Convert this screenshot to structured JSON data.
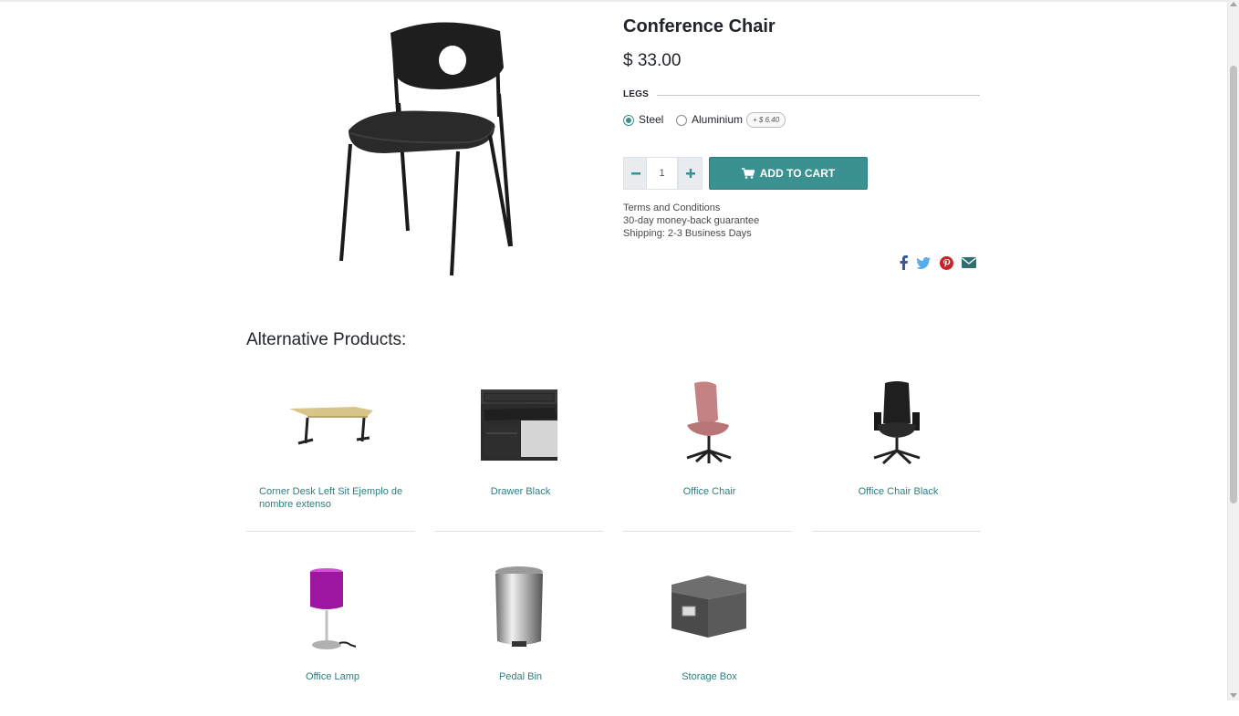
{
  "product": {
    "name": "Conference Chair",
    "price": "$ 33.00",
    "attribute": {
      "label": "LEGS",
      "options": [
        {
          "label": "Steel",
          "selected": true
        },
        {
          "label": "Aluminium",
          "selected": false,
          "extra_price": "+ $ 6.40"
        }
      ]
    },
    "quantity": "1",
    "add_to_cart_label": "ADD TO CART",
    "info": [
      "Terms and Conditions",
      "30-day money-back guarantee",
      "Shipping: 2-3 Business Days"
    ],
    "share_icons": [
      "facebook-icon",
      "twitter-icon",
      "pinterest-icon",
      "envelope-icon"
    ]
  },
  "alternatives": {
    "heading": "Alternative Products:",
    "items": [
      {
        "name": "Corner Desk Left Sit Ejemplo de nombre extenso",
        "icon": "desk-image"
      },
      {
        "name": "Drawer Black",
        "icon": "drawer-image"
      },
      {
        "name": "Office Chair",
        "icon": "office-chair-image"
      },
      {
        "name": "Office Chair Black",
        "icon": "office-chair-black-image"
      },
      {
        "name": "Office Lamp",
        "icon": "lamp-image"
      },
      {
        "name": "Pedal Bin",
        "icon": "pedal-bin-image"
      },
      {
        "name": "Storage Box",
        "icon": "storage-box-image"
      }
    ]
  },
  "colors": {
    "accent": "#3a9190",
    "link": "#2f7d7d",
    "facebook": "#3b5998",
    "twitter": "#55acee",
    "pinterest": "#cb2027",
    "email": "#2f6f6f"
  }
}
